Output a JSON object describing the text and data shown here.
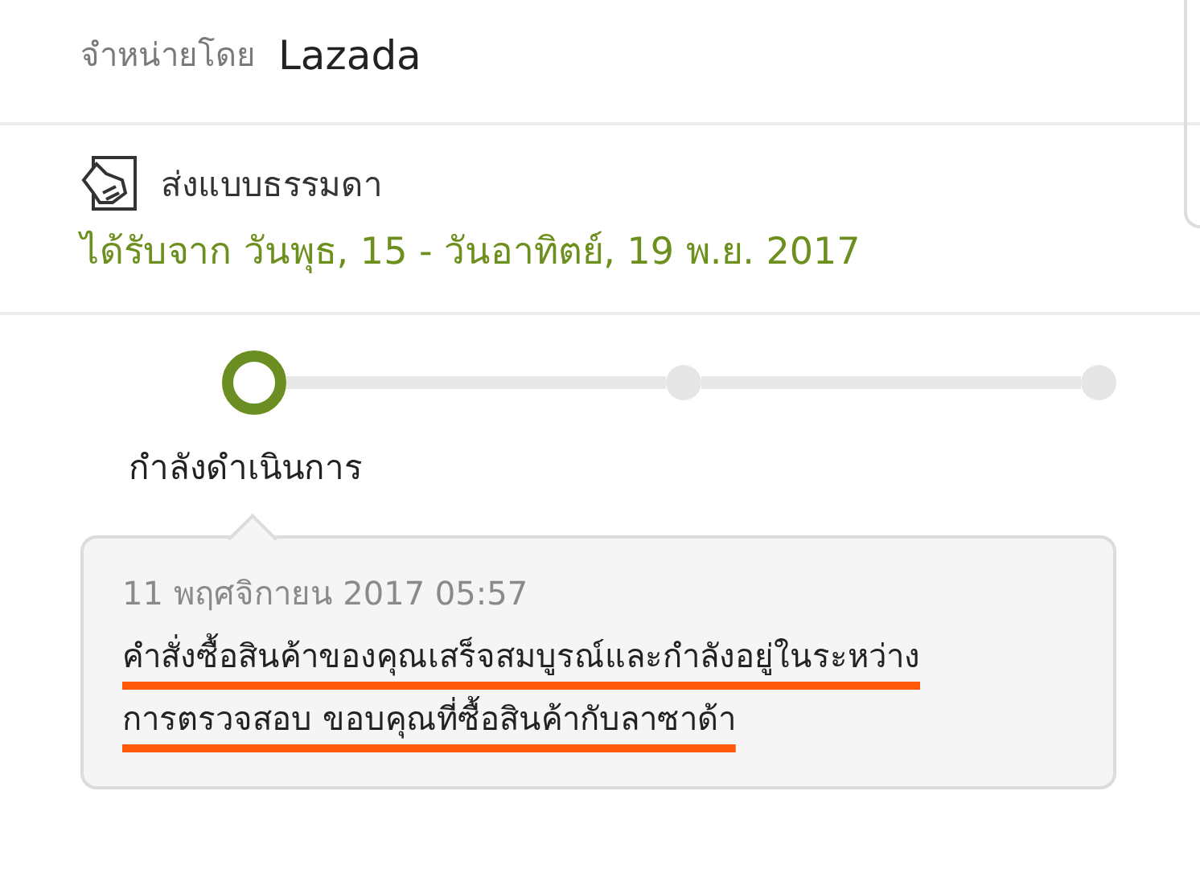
{
  "seller": {
    "label": "จำหน่ายโดย",
    "name": "Lazada"
  },
  "shipping": {
    "method": "ส่งแบบธรรมดา",
    "delivery": "ได้รับจาก วันพุธ, 15 - วันอาทิตย์, 19 พ.ย. 2017"
  },
  "steps": [
    {
      "label": "กำลังดำเนินการ",
      "current": true
    },
    {
      "current": false
    },
    {
      "current": false
    }
  ],
  "status_note": {
    "time": "11 พฤศจิกายน 2017 05:57",
    "message": "คำสั่งซื้อสินค้าของคุณเสร็จสมบูรณ์และกำลังอยู่ในระหว่าง การตรวจสอบ ขอบคุณที่ซื้อสินค้ากับลาซาด้า"
  }
}
